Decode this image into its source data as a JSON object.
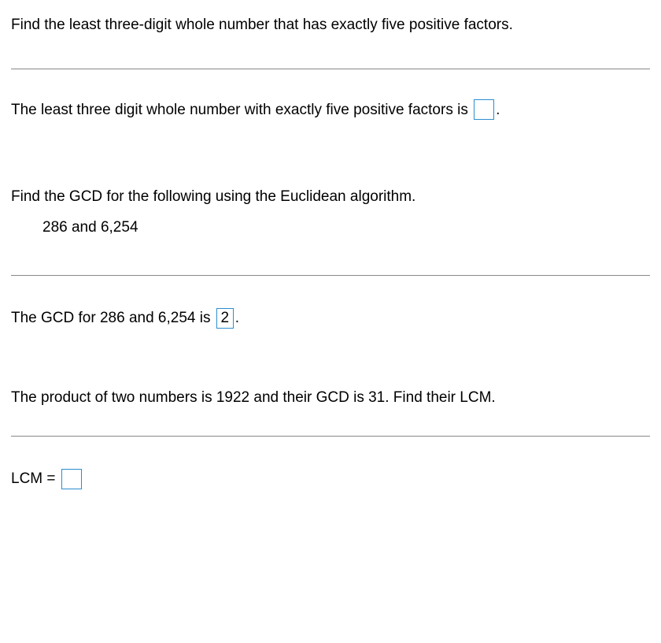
{
  "q1": {
    "prompt": "Find the least three-digit whole number that has exactly five positive factors.",
    "answer_prefix": "The least three digit whole number with exactly five positive factors is",
    "answer_value": "",
    "period": "."
  },
  "q2": {
    "prompt": "Find the GCD for the following using the Euclidean algorithm.",
    "numbers": "286 and 6,254",
    "answer_prefix": "The GCD for 286 and 6,254 is",
    "answer_value": "2",
    "period": "."
  },
  "q3": {
    "prompt": "The product of two numbers is 1922 and their GCD is 31. Find their LCM.",
    "answer_prefix": "LCM =",
    "answer_value": ""
  }
}
